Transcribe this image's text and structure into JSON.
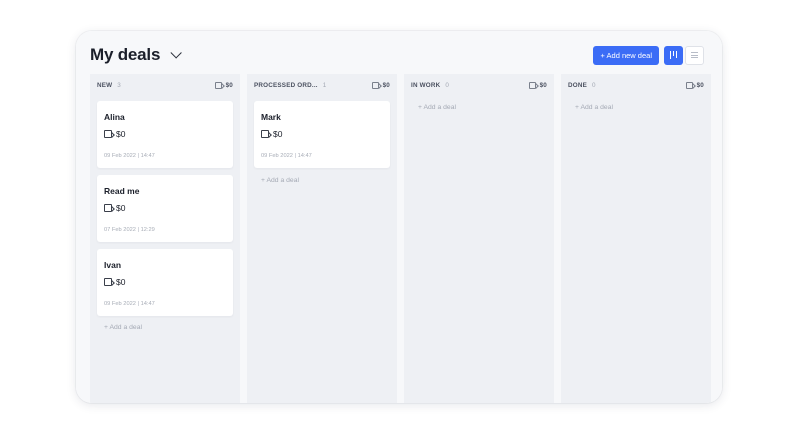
{
  "header": {
    "title": "My deals",
    "add_button_label": "+ Add new deal"
  },
  "icons": {
    "title_dropdown": "chevron-down-icon",
    "kanban_view": "kanban-view-icon",
    "list_view": "list-view-icon",
    "amount": "document-money-icon"
  },
  "colors": {
    "accent": "#3b6cf6",
    "column_bg": "#eef0f4",
    "page_bg": "#f7f8fa"
  },
  "columns": [
    {
      "title": "NEW",
      "count": "3",
      "sum": "$0",
      "add_label": "+ Add a deal",
      "cards": [
        {
          "name": "Alina",
          "amount": "$0",
          "date": "09 Feb 2022 | 14:47"
        },
        {
          "name": "Read me",
          "amount": "$0",
          "date": "07 Feb 2022 | 12:29"
        },
        {
          "name": "Ivan",
          "amount": "$0",
          "date": "09 Feb 2022 | 14:47"
        }
      ]
    },
    {
      "title": "PROCESSED ORD...",
      "count": "1",
      "sum": "$0",
      "add_label": "+ Add a deal",
      "cards": [
        {
          "name": "Mark",
          "amount": "$0",
          "date": "09 Feb 2022 | 14:47"
        }
      ]
    },
    {
      "title": "IN WORK",
      "count": "0",
      "sum": "$0",
      "add_label": "+ Add a deal",
      "cards": []
    },
    {
      "title": "DONE",
      "count": "0",
      "sum": "$0",
      "add_label": "+ Add a deal",
      "cards": []
    }
  ]
}
